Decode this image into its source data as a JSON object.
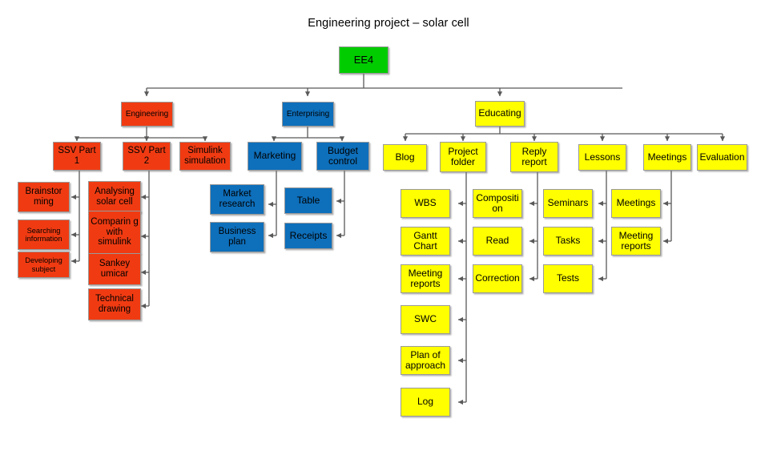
{
  "title": "Engineering project – solar cell",
  "colors": {
    "green": "#00CC00",
    "red": "#F03B12",
    "blue": "#0E6FBB",
    "yellow": "#FFFF00",
    "connector": "#595959",
    "border": "#9A9A9A",
    "text": "#000000",
    "background": "#FFFFFF"
  },
  "chart_data": {
    "type": "diagram",
    "subtype": "organizational-tree",
    "title": "Engineering project – solar cell",
    "root": "EE4",
    "nodes": [
      {
        "id": "ee4",
        "label": "EE4",
        "color": "green",
        "level": 0,
        "parent": null
      },
      {
        "id": "engineering",
        "label": "Engineering",
        "color": "red",
        "level": 1,
        "parent": "ee4"
      },
      {
        "id": "enterprising",
        "label": "Enterprising",
        "color": "blue",
        "level": 1,
        "parent": "ee4"
      },
      {
        "id": "educating",
        "label": "Educating",
        "color": "yellow",
        "level": 1,
        "parent": "ee4"
      },
      {
        "id": "ssv1",
        "label": "SSV Part 1",
        "color": "red",
        "level": 2,
        "parent": "engineering"
      },
      {
        "id": "ssv2",
        "label": "SSV Part 2",
        "color": "red",
        "level": 2,
        "parent": "engineering"
      },
      {
        "id": "simulink",
        "label": "Simulink simulation",
        "color": "red",
        "level": 2,
        "parent": "engineering"
      },
      {
        "id": "brainstorming",
        "label": "Brainstor ming",
        "color": "red",
        "level": 3,
        "parent": "ssv1"
      },
      {
        "id": "searching",
        "label": "Searching information",
        "color": "red",
        "level": 3,
        "parent": "ssv1"
      },
      {
        "id": "developing",
        "label": "Developing subject",
        "color": "red",
        "level": 3,
        "parent": "ssv1"
      },
      {
        "id": "analysing",
        "label": "Analysing solar cell",
        "color": "red",
        "level": 3,
        "parent": "ssv2"
      },
      {
        "id": "comparing",
        "label": "Comparin g with simulink",
        "color": "red",
        "level": 3,
        "parent": "ssv2"
      },
      {
        "id": "sankey",
        "label": "Sankey umicar",
        "color": "red",
        "level": 3,
        "parent": "ssv2"
      },
      {
        "id": "technical",
        "label": "Technical drawing",
        "color": "red",
        "level": 3,
        "parent": "ssv2"
      },
      {
        "id": "marketing",
        "label": "Marketing",
        "color": "blue",
        "level": 2,
        "parent": "enterprising"
      },
      {
        "id": "budget",
        "label": "Budget control",
        "color": "blue",
        "level": 2,
        "parent": "enterprising"
      },
      {
        "id": "marketresearch",
        "label": "Market research",
        "color": "blue",
        "level": 3,
        "parent": "marketing"
      },
      {
        "id": "businessplan",
        "label": "Business plan",
        "color": "blue",
        "level": 3,
        "parent": "marketing"
      },
      {
        "id": "table",
        "label": "Table",
        "color": "blue",
        "level": 3,
        "parent": "budget"
      },
      {
        "id": "receipts",
        "label": "Receipts",
        "color": "blue",
        "level": 3,
        "parent": "budget"
      },
      {
        "id": "blog",
        "label": "Blog",
        "color": "yellow",
        "level": 2,
        "parent": "educating"
      },
      {
        "id": "projectfolder",
        "label": "Project folder",
        "color": "yellow",
        "level": 2,
        "parent": "educating"
      },
      {
        "id": "replyreport",
        "label": "Reply report",
        "color": "yellow",
        "level": 2,
        "parent": "educating"
      },
      {
        "id": "lessons",
        "label": "Lessons",
        "color": "yellow",
        "level": 2,
        "parent": "educating"
      },
      {
        "id": "meetings",
        "label": "Meetings",
        "color": "yellow",
        "level": 2,
        "parent": "educating"
      },
      {
        "id": "evaluation",
        "label": "Evaluation",
        "color": "yellow",
        "level": 2,
        "parent": "educating"
      },
      {
        "id": "wbs",
        "label": "WBS",
        "color": "yellow",
        "level": 3,
        "parent": "blog"
      },
      {
        "id": "gantt",
        "label": "Gantt Chart",
        "color": "yellow",
        "level": 3,
        "parent": "blog"
      },
      {
        "id": "meetingreports1",
        "label": "Meeting reports",
        "color": "yellow",
        "level": 3,
        "parent": "blog"
      },
      {
        "id": "swc",
        "label": "SWC",
        "color": "yellow",
        "level": 3,
        "parent": "blog"
      },
      {
        "id": "planofapproach",
        "label": "Plan of approach",
        "color": "yellow",
        "level": 3,
        "parent": "blog"
      },
      {
        "id": "log",
        "label": "Log",
        "color": "yellow",
        "level": 3,
        "parent": "blog"
      },
      {
        "id": "composition",
        "label": "Compositi on",
        "color": "yellow",
        "level": 3,
        "parent": "projectfolder"
      },
      {
        "id": "read",
        "label": "Read",
        "color": "yellow",
        "level": 3,
        "parent": "projectfolder"
      },
      {
        "id": "correction",
        "label": "Correction",
        "color": "yellow",
        "level": 3,
        "parent": "projectfolder"
      },
      {
        "id": "seminars",
        "label": "Seminars",
        "color": "yellow",
        "level": 3,
        "parent": "lessons"
      },
      {
        "id": "tasks",
        "label": "Tasks",
        "color": "yellow",
        "level": 3,
        "parent": "lessons"
      },
      {
        "id": "tests",
        "label": "Tests",
        "color": "yellow",
        "level": 3,
        "parent": "lessons"
      },
      {
        "id": "meetings2",
        "label": "Meetings",
        "color": "yellow",
        "level": 3,
        "parent": "meetings"
      },
      {
        "id": "meetingreports2",
        "label": "Meeting reports",
        "color": "yellow",
        "level": 3,
        "parent": "meetings"
      }
    ]
  },
  "nodes": {
    "ee4": "EE4",
    "engineering": "Engineering",
    "enterprising": "Enterprising",
    "educating": "Educating",
    "ssv1": "SSV Part 1",
    "ssv2": "SSV Part 2",
    "simulink": "Simulink simulation",
    "brainstorming": "Brainstor ming",
    "searching": "Searching information",
    "developing": "Developing subject",
    "analysing": "Analysing solar cell",
    "comparing": "Comparin g with simulink",
    "sankey": "Sankey umicar",
    "technical": "Technical drawing",
    "marketing": "Marketing",
    "budget": "Budget control",
    "marketresearch": "Market research",
    "businessplan": "Business plan",
    "table": "Table",
    "receipts": "Receipts",
    "blog": "Blog",
    "projectfolder": "Project folder",
    "replyreport": "Reply report",
    "lessons": "Lessons",
    "meetings": "Meetings",
    "evaluation": "Evaluation",
    "wbs": "WBS",
    "gantt": "Gantt Chart",
    "meetingreports1": "Meeting reports",
    "swc": "SWC",
    "planofapproach": "Plan of approach",
    "log": "Log",
    "composition": "Compositi on",
    "read": "Read",
    "correction": "Correction",
    "seminars": "Seminars",
    "tasks": "Tasks",
    "tests": "Tests",
    "meetings2": "Meetings",
    "meetingreports2": "Meeting reports"
  }
}
